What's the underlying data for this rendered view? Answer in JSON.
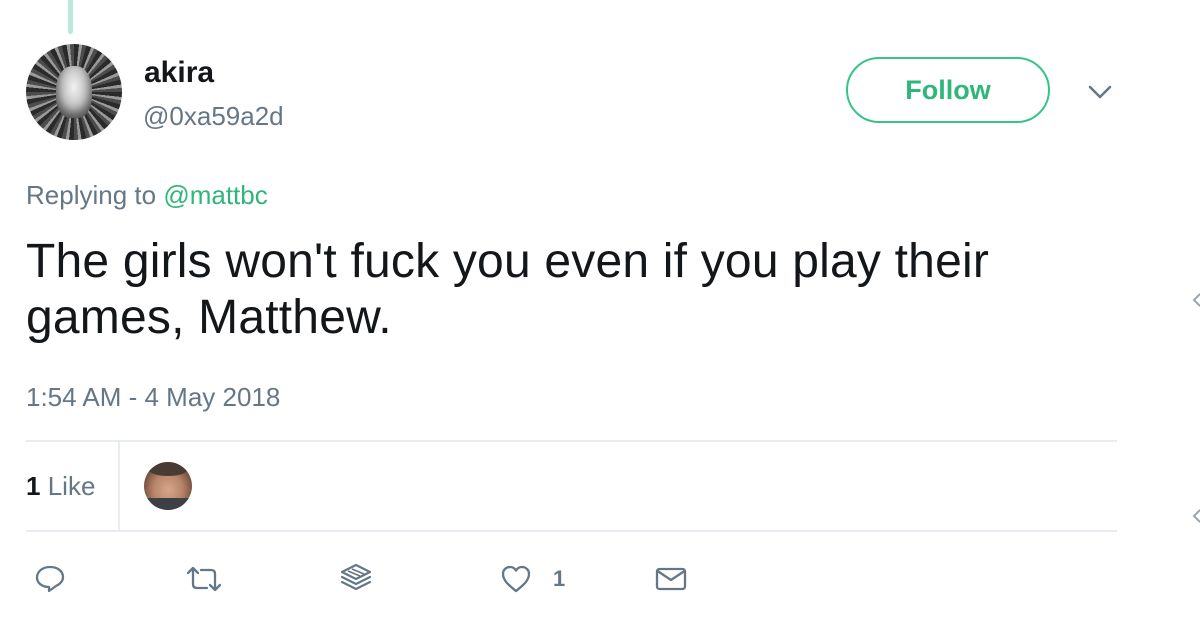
{
  "tweet": {
    "author": {
      "display_name": "akira",
      "handle": "@0xa59a2d"
    },
    "follow_label": "Follow",
    "replying_prefix": "Replying to",
    "replying_to": "@mattbc",
    "text": "The girls won't fuck you even if you play their games, Matthew.",
    "timestamp": "1:54 AM - 4 May 2018",
    "stats": {
      "like_count": "1",
      "like_label": "Like"
    },
    "actions": {
      "reply_icon": "reply-icon",
      "retweet_icon": "retweet-icon",
      "stack_icon": "stack-icon",
      "like_icon": "heart-icon",
      "like_count": "1",
      "message_icon": "envelope-icon"
    }
  },
  "colors": {
    "accent": "#2fb67a",
    "muted": "#657786",
    "divider": "#e6ecf0",
    "text": "#14171a"
  }
}
